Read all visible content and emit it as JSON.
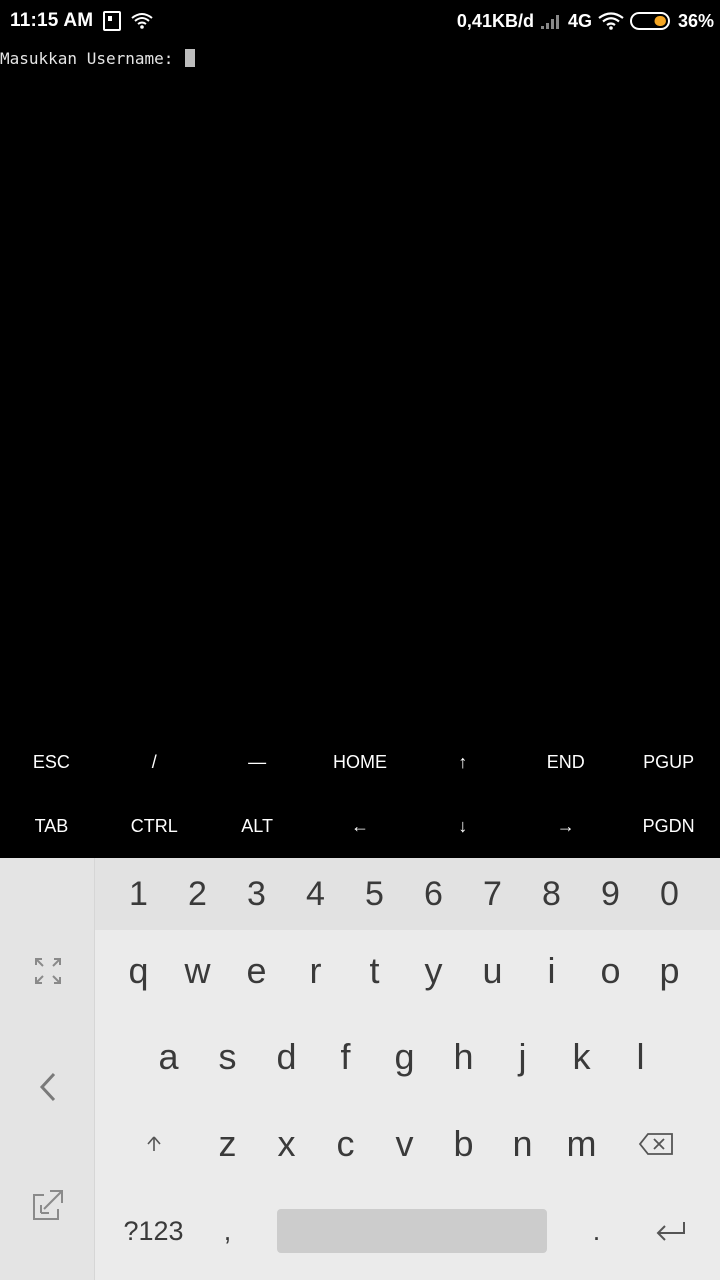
{
  "status_bar": {
    "time": "11:15 AM",
    "data_rate": "0,41KB/d",
    "network": "4G",
    "battery": "36%",
    "battery_level": 0.36,
    "accent_color": "#f5a623"
  },
  "terminal": {
    "prompt": "Masukkan Username: "
  },
  "extra_keys": {
    "row1": [
      "ESC",
      "/",
      "—",
      "HOME",
      "↑",
      "END",
      "PGUP"
    ],
    "row2": [
      "TAB",
      "CTRL",
      "ALT",
      "←",
      "↓",
      "→",
      "PGDN"
    ]
  },
  "keyboard": {
    "numbers": [
      "1",
      "2",
      "3",
      "4",
      "5",
      "6",
      "7",
      "8",
      "9",
      "0"
    ],
    "row1": [
      "q",
      "w",
      "e",
      "r",
      "t",
      "y",
      "u",
      "i",
      "o",
      "p"
    ],
    "row2": [
      "a",
      "s",
      "d",
      "f",
      "g",
      "h",
      "j",
      "k",
      "l"
    ],
    "row3": [
      "z",
      "x",
      "c",
      "v",
      "b",
      "n",
      "m"
    ],
    "symbols_label": "?123",
    "comma": ",",
    "period": ".",
    "icons": {
      "expand": "expand-icon",
      "back": "chevron-left-icon",
      "float": "floating-keyboard-icon",
      "shift": "shift-icon",
      "backspace": "backspace-icon",
      "enter": "enter-icon"
    }
  }
}
